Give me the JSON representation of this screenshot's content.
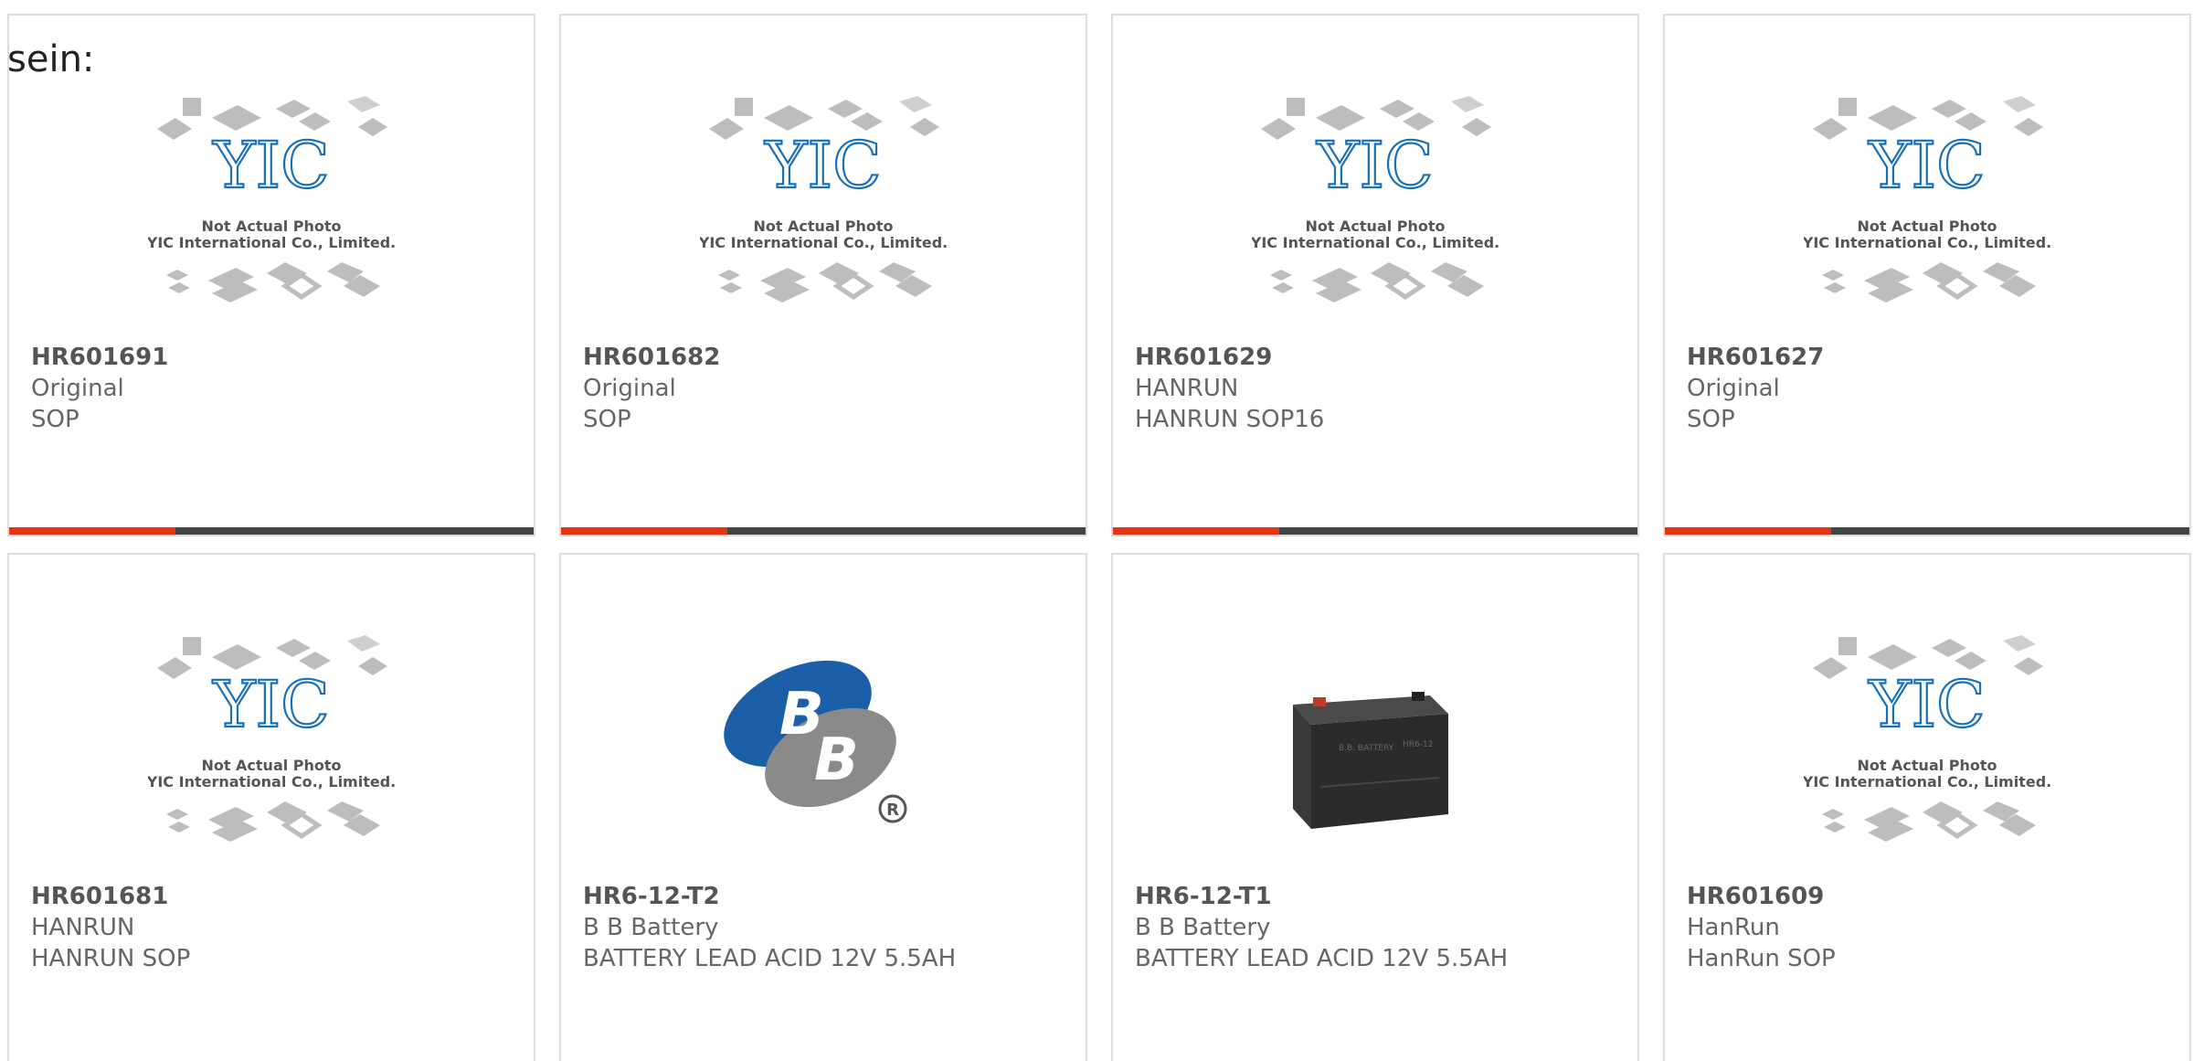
{
  "header": {
    "fragment_text": "sein:"
  },
  "placeholder_image": {
    "line1": "Not Actual Photo",
    "line2": "YIC International Co., Limited.",
    "logo_text": "YIC"
  },
  "colors": {
    "accent": "#e63312",
    "bar": "#444444",
    "border": "#dddddd",
    "logo_blue": "#1a6fb5",
    "text": "#666666"
  },
  "products": [
    {
      "part": "HR601691",
      "brand": "Original",
      "desc": "SOP",
      "image": "yic-placeholder-icon"
    },
    {
      "part": "HR601682",
      "brand": "Original",
      "desc": "SOP",
      "image": "yic-placeholder-icon"
    },
    {
      "part": "HR601629",
      "brand": "HANRUN",
      "desc": "HANRUN SOP16",
      "image": "yic-placeholder-icon"
    },
    {
      "part": "HR601627",
      "brand": "Original",
      "desc": "SOP",
      "image": "yic-placeholder-icon"
    },
    {
      "part": "HR601681",
      "brand": "HANRUN",
      "desc": "HANRUN SOP",
      "image": "yic-placeholder-icon"
    },
    {
      "part": "HR6-12-T2",
      "brand": "B B Battery",
      "desc": "BATTERY LEAD ACID 12V 5.5AH",
      "image": "bb-battery-logo-icon"
    },
    {
      "part": "HR6-12-T1",
      "brand": "B B Battery",
      "desc": "BATTERY LEAD ACID 12V 5.5AH",
      "image": "battery-photo-icon"
    },
    {
      "part": "HR601609",
      "brand": "HanRun",
      "desc": "HanRun SOP",
      "image": "yic-placeholder-icon"
    }
  ]
}
